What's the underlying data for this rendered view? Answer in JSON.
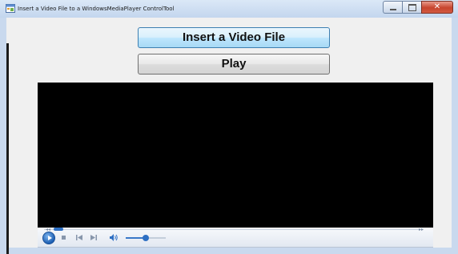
{
  "window": {
    "title": "Insert a Video File to a WindowsMediaPlayer ControlTool",
    "icon": "app-form-icon",
    "caption_buttons": [
      "minimize-icon",
      "maximize-icon",
      "close-icon"
    ],
    "close_glyph": "✕"
  },
  "buttons": {
    "insert_label": "Insert a Video File",
    "play_label": "Play"
  },
  "player": {
    "screen_color": "#000000",
    "seek_position": 0.0,
    "volume_level": 0.5,
    "control_icons": [
      "play-icon",
      "stop-icon",
      "previous-icon",
      "next-icon",
      "volume-icon"
    ]
  },
  "colors": {
    "accent": "#2d6fc3",
    "window_frame": "#c9d9ee",
    "client_bg": "#f0f0f0"
  }
}
